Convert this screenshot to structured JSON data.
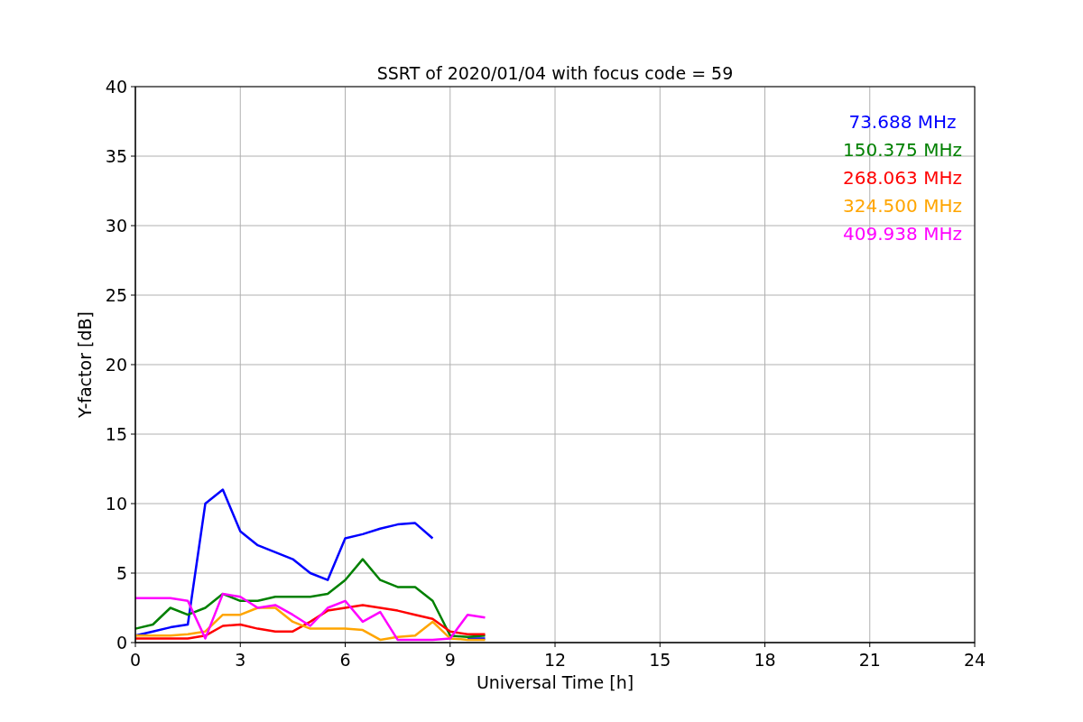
{
  "chart_data": {
    "type": "line",
    "title": "SSRT of 2020/01/04 with focus code = 59",
    "xlabel": "Universal Time [h]",
    "ylabel": "Y-factor [dB]",
    "x": [
      0,
      0.5,
      1,
      1.5,
      2,
      2.5,
      3,
      3.5,
      4,
      4.5,
      5,
      5.5,
      6,
      6.5,
      7,
      7.5,
      8,
      8.5,
      9,
      9.5,
      10
    ],
    "series": [
      {
        "name": "73.688 MHz",
        "color": "#0000ff",
        "values": [
          0.5,
          0.8,
          1.1,
          1.3,
          10,
          11,
          8,
          7,
          6.5,
          6,
          5,
          4.5,
          7.5,
          7.8,
          8.2,
          8.5,
          8.6,
          7.5,
          null,
          0.3,
          0.3
        ]
      },
      {
        "name": "150.375 MHz",
        "color": "#008000",
        "values": [
          1,
          1.3,
          2.5,
          2,
          2.5,
          3.5,
          3,
          3,
          3.3,
          3.3,
          3.3,
          3.5,
          4.5,
          6,
          4.5,
          4,
          4,
          3,
          0.5,
          0.4,
          0.5
        ]
      },
      {
        "name": "268.063 MHz",
        "color": "#ff0000",
        "values": [
          0.3,
          0.3,
          0.3,
          0.3,
          0.5,
          1.2,
          1.3,
          1,
          0.8,
          0.8,
          1.5,
          2.3,
          2.5,
          2.7,
          2.5,
          2.3,
          2,
          1.7,
          0.8,
          0.6,
          0.6
        ]
      },
      {
        "name": "324.500 MHz",
        "color": "#ffa500",
        "values": [
          0.5,
          0.5,
          0.5,
          0.6,
          0.8,
          2,
          2,
          2.5,
          2.5,
          1.5,
          1,
          1,
          1,
          0.9,
          0.2,
          0.4,
          0.5,
          1.5,
          0.3,
          0.2,
          0.2
        ]
      },
      {
        "name": "409.938 MHz",
        "color": "#ff00ff",
        "values": [
          3.2,
          3.2,
          3.2,
          3,
          0.3,
          3.5,
          3.3,
          2.5,
          2.7,
          2,
          1.2,
          2.5,
          3,
          1.5,
          2.2,
          0.2,
          0.2,
          0.2,
          0.3,
          2,
          1.8
        ]
      }
    ],
    "grid": true,
    "xlim": [
      0,
      24
    ],
    "ylim": [
      0,
      40
    ],
    "xticks": [
      0,
      3,
      6,
      9,
      12,
      15,
      18,
      21,
      24
    ],
    "yticks": [
      0,
      5,
      10,
      15,
      20,
      25,
      30,
      35,
      40
    ]
  }
}
